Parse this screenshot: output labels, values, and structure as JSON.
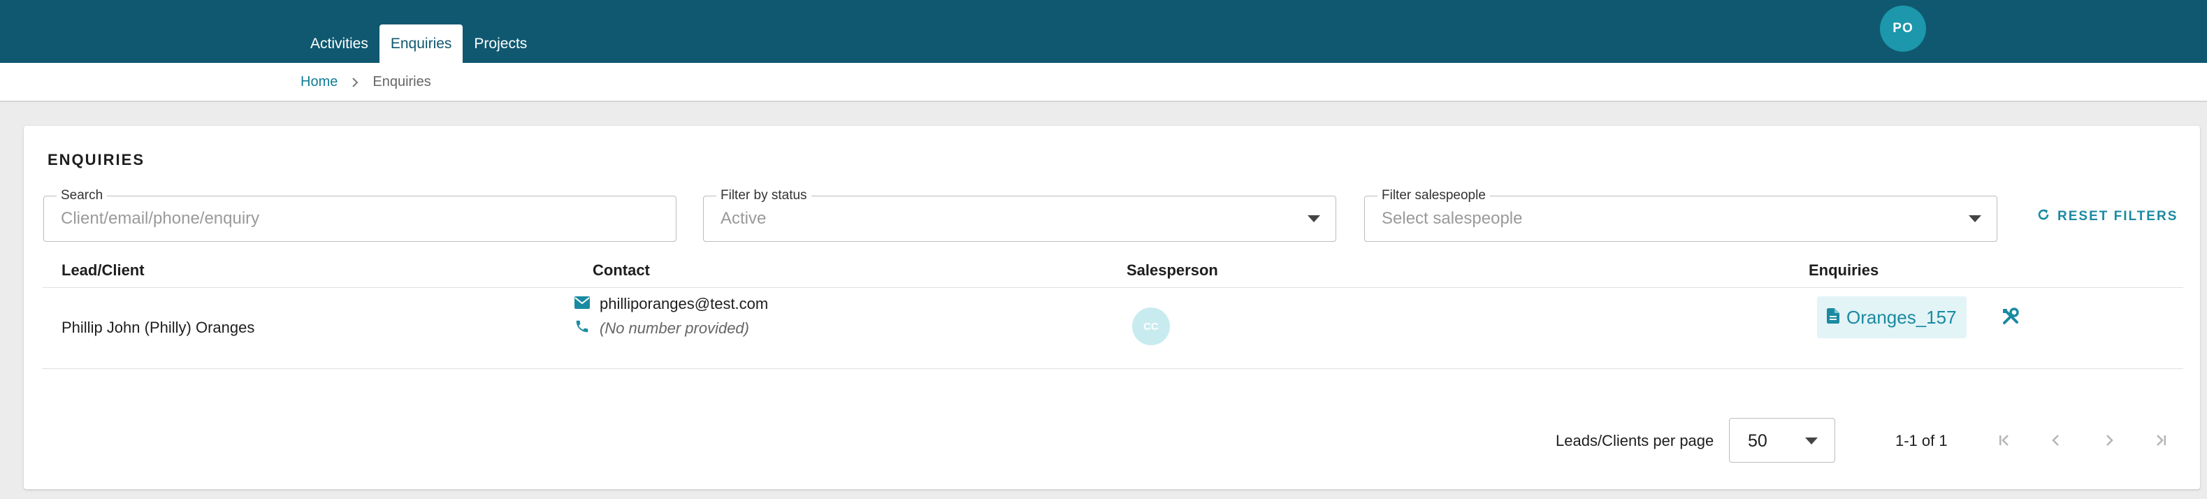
{
  "nav": {
    "tabs": [
      {
        "label": "Activities",
        "active": false
      },
      {
        "label": "Enquiries",
        "active": true
      },
      {
        "label": "Projects",
        "active": false
      }
    ],
    "user_initials": "PO"
  },
  "breadcrumb": {
    "home": "Home",
    "current": "Enquiries"
  },
  "page": {
    "title": "ENQUIRIES"
  },
  "filters": {
    "search": {
      "label": "Search",
      "placeholder": "Client/email/phone/enquiry",
      "value": ""
    },
    "status": {
      "label": "Filter by status",
      "value": "Active"
    },
    "salespeople": {
      "label": "Filter salespeople",
      "value": "Select salespeople"
    },
    "reset_label": "RESET FILTERS"
  },
  "table": {
    "columns": [
      "Lead/Client",
      "Contact",
      "Salesperson",
      "Enquiries"
    ],
    "rows": [
      {
        "client": "Phillip John (Philly) Oranges",
        "email": "philliporanges@test.com",
        "phone": "(No number provided)",
        "salesperson_initials": "CC",
        "enquiry": "Oranges_157"
      }
    ]
  },
  "pagination": {
    "per_page_label": "Leads/Clients per page",
    "per_page_value": "50",
    "range": "1-1 of 1"
  },
  "colors": {
    "brand": "#0f5870",
    "accent": "#1a8aa1",
    "avatar": "#1c97ab"
  },
  "icons": {
    "reset": "refresh-icon",
    "email": "envelope-icon",
    "phone": "phone-icon",
    "enquiry": "document-icon",
    "tools": "tools-icon"
  }
}
